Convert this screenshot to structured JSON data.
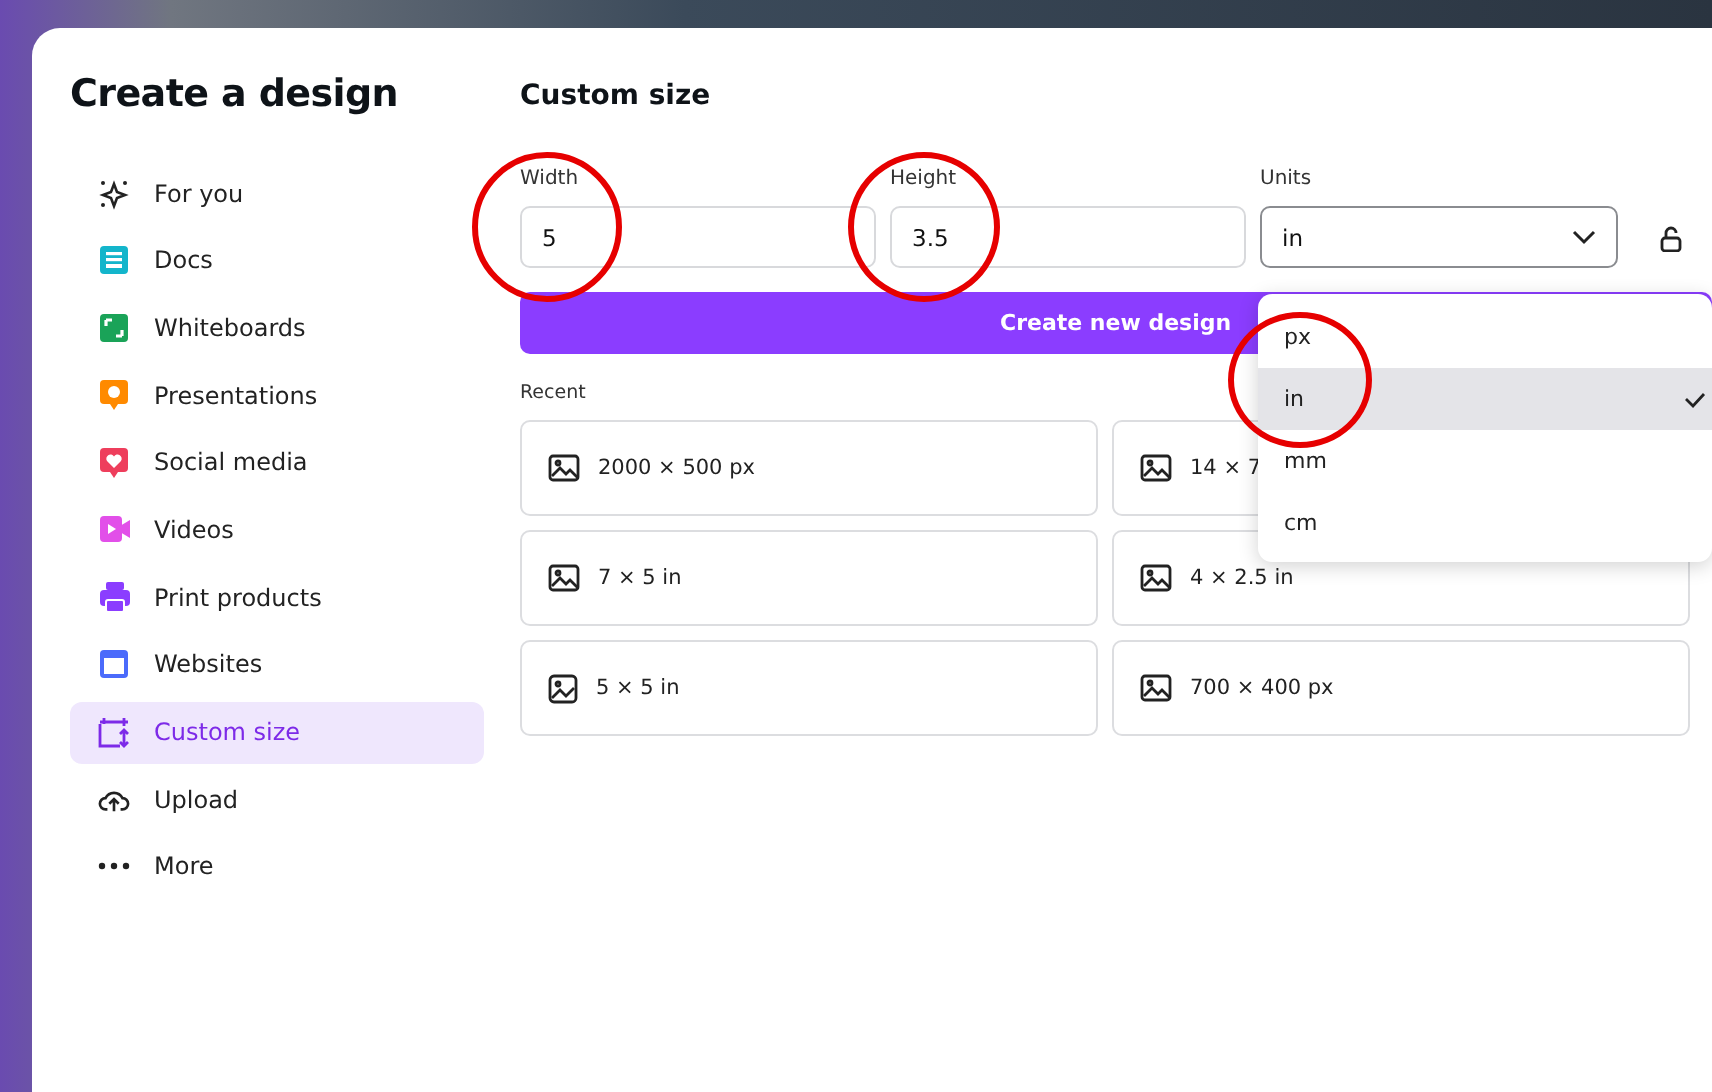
{
  "dialog": {
    "title": "Create a design"
  },
  "sidebar": {
    "items": [
      {
        "label": "For you",
        "selected": false
      },
      {
        "label": "Docs",
        "selected": false
      },
      {
        "label": "Whiteboards",
        "selected": false
      },
      {
        "label": "Presentations",
        "selected": false
      },
      {
        "label": "Social media",
        "selected": false
      },
      {
        "label": "Videos",
        "selected": false
      },
      {
        "label": "Print products",
        "selected": false
      },
      {
        "label": "Websites",
        "selected": false
      },
      {
        "label": "Custom size",
        "selected": true
      },
      {
        "label": "Upload",
        "selected": false
      },
      {
        "label": "More",
        "selected": false
      }
    ]
  },
  "custom_size": {
    "title": "Custom size",
    "width": {
      "label": "Width",
      "value": "5"
    },
    "height": {
      "label": "Height",
      "value": "3.5"
    },
    "units": {
      "label": "Units",
      "value": "in"
    },
    "create_button": "Create new design",
    "recent_label": "Recent",
    "recent": [
      {
        "label": "2000 × 500 px"
      },
      {
        "label": "14 × 7"
      },
      {
        "label": "7 × 5 in"
      },
      {
        "label": "4 × 2.5 in"
      },
      {
        "label": "5 × 5 in"
      },
      {
        "label": "700 × 400 px"
      }
    ]
  },
  "units_menu": [
    {
      "label": "px",
      "selected": false
    },
    {
      "label": "in",
      "selected": true
    },
    {
      "label": "mm",
      "selected": false
    },
    {
      "label": "cm",
      "selected": false
    }
  ]
}
